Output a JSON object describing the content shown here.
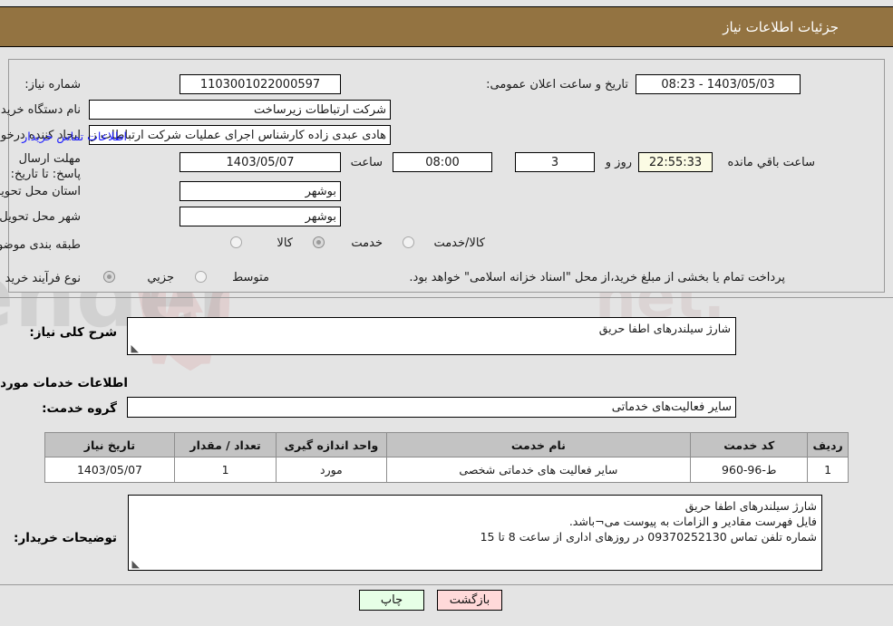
{
  "header": {
    "title": "جزئیات اطلاعات نیاز"
  },
  "fields": {
    "need_number_label": "شماره نیاز:",
    "need_number_value": "1103001022000597",
    "public_announce_label": "تاریخ و ساعت اعلان عمومی:",
    "public_announce_value": "1403/05/03 - 08:23",
    "buyer_org_label": "نام دستگاه خریدار:",
    "buyer_org_value": "شرکت ارتباطات زیرساخت",
    "creator_label": "ایجاد کننده درخواست:",
    "creator_value": "هادی عبدی زاده کارشناس اجرای عملیات شرکت ارتباطات زیرساخت",
    "contact_link": "اطلاعات تماس خریدار",
    "deadline_label": "مهلت ارسال پاسخ: تا تاریخ:",
    "deadline_date": "1403/05/07",
    "hour_label": "ساعت",
    "deadline_time": "08:00",
    "days_remaining": "3",
    "days_label": "روز و",
    "time_remaining": "22:55:33",
    "remaining_label": "ساعت باقي مانده",
    "province_label": "استان محل تحویل:",
    "province_value": "بوشهر",
    "city_label": "شهر محل تحویل:",
    "city_value": "بوشهر",
    "category_label": "طبقه بندی موضوعی:",
    "category_options": [
      "کالا",
      "خدمت",
      "کالا/خدمت"
    ],
    "category_selected": "خدمت",
    "process_label": "نوع فرآیند خرید :",
    "process_options": [
      "جزیي",
      "متوسط"
    ],
    "process_selected": "جزیي",
    "treasury_note": "پرداخت تمام یا بخشی از مبلغ خرید،از محل \"اسناد خزانه اسلامی\" خواهد بود."
  },
  "description": {
    "label": "شرح کلی نیاز:",
    "value": "شارژ سیلندرهای اطفا حریق"
  },
  "services_section": {
    "heading": "اطلاعات خدمات مورد نیاز",
    "group_label": "گروه خدمت:",
    "group_value": "سایر فعالیت‌های خدماتی"
  },
  "table": {
    "headers": [
      "ردیف",
      "کد خدمت",
      "نام خدمت",
      "واحد اندازه گیری",
      "تعداد / مقدار",
      "تاریخ نیاز"
    ],
    "rows": [
      {
        "row": "1",
        "code": "ط-96-960",
        "name": "سایر فعالیت های خدماتی شخصی",
        "unit": "مورد",
        "quantity": "1",
        "need_date": "1403/05/07"
      }
    ]
  },
  "buyer_notes": {
    "label": "توضیحات خریدار:",
    "line1": "شارژ سیلندرهای اطفا حریق",
    "line2": "فایل فهرست مقادیر و الزامات به پیوست می¬باشد.",
    "line3": "شماره تلفن تماس 09370252130 در روزهای اداری از ساعت 8 تا 15"
  },
  "actions": {
    "print": "چاپ",
    "back": "بازگشت"
  },
  "colors": {
    "header_bg": "#937341",
    "page_bg": "#e4e4e4",
    "link": "#1a1aff",
    "table_header_bg": "#c3c3c3",
    "print_btn": "#e6ffe6",
    "back_btn": "#ffd9d9",
    "countdown_bg": "#fbfbe4"
  }
}
